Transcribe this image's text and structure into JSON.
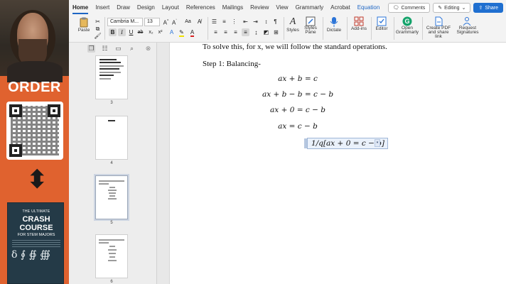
{
  "promo": {
    "order_label": "ORDER",
    "book": {
      "top": "THE ULTIMATE",
      "title_line1": "CRASH COURSE",
      "subtitle": "FOR STEM MAJORS",
      "glyphs": "δ ∮ ∯ ∰"
    }
  },
  "ribbon": {
    "tabs": [
      "Home",
      "Insert",
      "Draw",
      "Design",
      "Layout",
      "References",
      "Mailings",
      "Review",
      "View",
      "Grammarly",
      "Acrobat",
      "Equation"
    ],
    "comments_label": "Comments",
    "editing_label": "Editing",
    "share_label": "Share",
    "paste_label": "Paste",
    "font_name": "Cambria M...",
    "font_size": "13",
    "styles_label": "Styles",
    "styles_pane_label": "Styles Pane",
    "dictate_label": "Dictate",
    "addins_label": "Add-ins",
    "editor_label": "Editor",
    "grammarly_label": "Open Grammarly",
    "create_pdf_label": "Create PDF and share link",
    "request_sig_label": "Request Signatures"
  },
  "thumbnails": {
    "pages": [
      {
        "number": "3"
      },
      {
        "number": "4"
      },
      {
        "number": "5"
      },
      {
        "number": "6"
      }
    ]
  },
  "document": {
    "intro": "To solve this, for x, we will follow the standard operations.",
    "step": "Step 1: Balancing-",
    "equations": [
      "ax + b = c",
      "ax + b − b = c − b",
      "ax + 0 = c − b",
      "ax = c − b"
    ],
    "active_equation": "1/q[ax + 0 = c − b]"
  },
  "colors": {
    "accent": "#1e66c4",
    "promo_bg": "#e0622f",
    "share_bg": "#1f6fd0"
  }
}
